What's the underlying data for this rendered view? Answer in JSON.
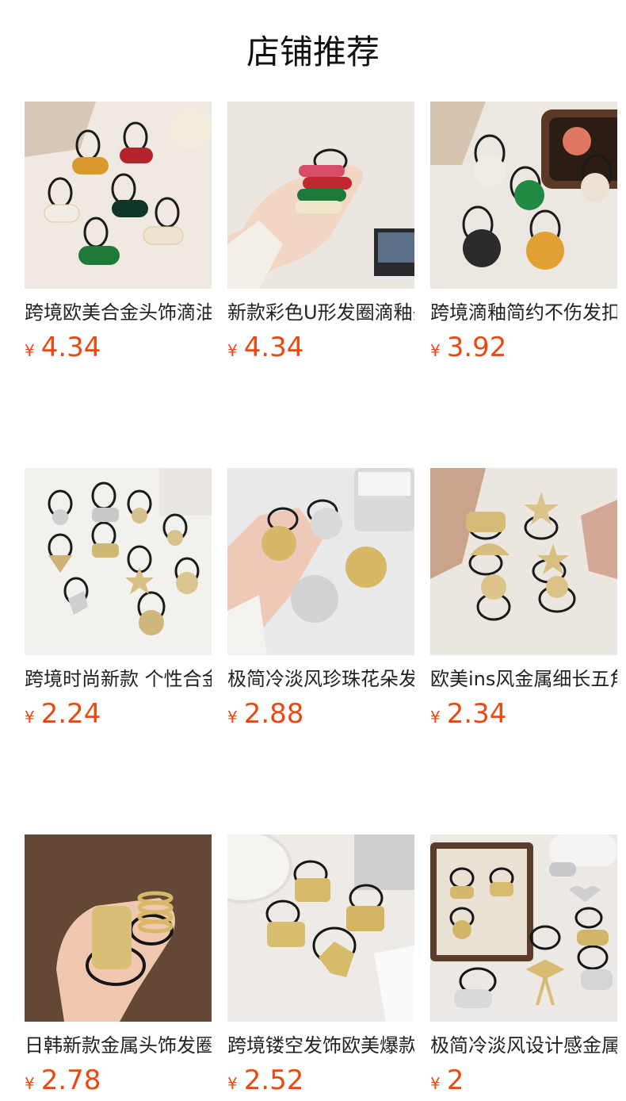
{
  "page": {
    "title": "店铺推荐"
  },
  "currency": "¥",
  "products": [
    {
      "name": "跨境欧美合金头饰滴油发圈",
      "price": "4.34",
      "image": "colored-enamel-hair-ties"
    },
    {
      "name": "新款彩色U形发圈滴釉头绳",
      "price": "4.34",
      "image": "hand-holding-u-shape-hair-ties"
    },
    {
      "name": "跨境滴釉简约不伤发扣头绳",
      "price": "3.92",
      "image": "round-enamel-button-hair-ties"
    },
    {
      "name": "跨境时尚新款 个性合金发圈",
      "price": "2.24",
      "image": "gold-metal-charm-hair-ties"
    },
    {
      "name": "极简冷淡风珍珠花朵发圈",
      "price": "2.88",
      "image": "metal-flower-hair-ties"
    },
    {
      "name": "欧美ins风金属细长五角星发圈",
      "price": "2.34",
      "image": "starfish-shell-hair-ties"
    },
    {
      "name": "日韩新款金属头饰发圈",
      "price": "2.78",
      "image": "hand-holding-metal-cuff-hair-tie"
    },
    {
      "name": "跨境镂空发饰欧美爆款发圈",
      "price": "2.52",
      "image": "textured-gold-butterfly-hair-ties"
    },
    {
      "name": "极简冷淡风设计感金属发圈",
      "price": "2",
      "image": "bow-and-ring-metal-hair-ties"
    }
  ]
}
